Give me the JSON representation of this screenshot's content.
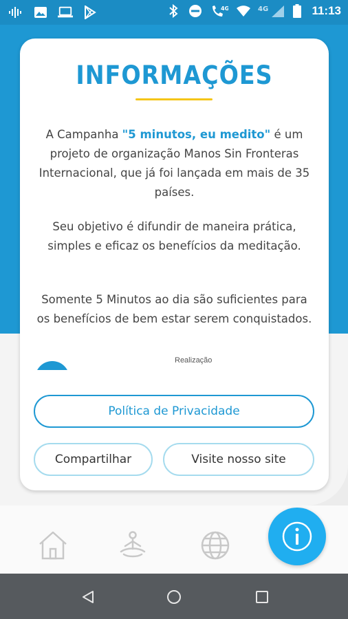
{
  "status_bar": {
    "time": "11:13",
    "network_label": "4G",
    "network_label_2": "4G",
    "icons_left": [
      "sound-icon",
      "gallery-icon",
      "laptop-icon",
      "play-store-icon"
    ],
    "icons_right": [
      "bluetooth-icon",
      "do-not-disturb-icon",
      "phone-4g-icon",
      "wifi-icon",
      "signal-icon",
      "battery-icon"
    ]
  },
  "card": {
    "title": "INFORMAÇÕES",
    "paragraph1_prefix": "A Campanha ",
    "paragraph1_highlight": "\"5 minutos, eu medito\"",
    "paragraph1_suffix": " é um projeto de organização Manos Sin Fronteras Internacional, que já foi lançada em mais de 35 países.",
    "paragraph2": "Seu objetivo é difundir de maneira prática, simples e eficaz os benefícios da meditação.",
    "paragraph3": "Somente 5 Minutos ao dia são suficientes para os benefícios de bem estar serem conquistados.",
    "partners_label": "Realização",
    "privacy_button": "Política de Privacidade",
    "share_button": "Compartilhar",
    "site_button": "Visite nosso site"
  },
  "tab_bar": {
    "items": [
      "home-icon",
      "meditation-icon",
      "globe-icon",
      "info-icon"
    ],
    "active": "info-icon"
  },
  "colors": {
    "accent": "#1e98d3",
    "underline": "#f5c518",
    "fab": "#20aef0",
    "nav": "#565a5e"
  }
}
